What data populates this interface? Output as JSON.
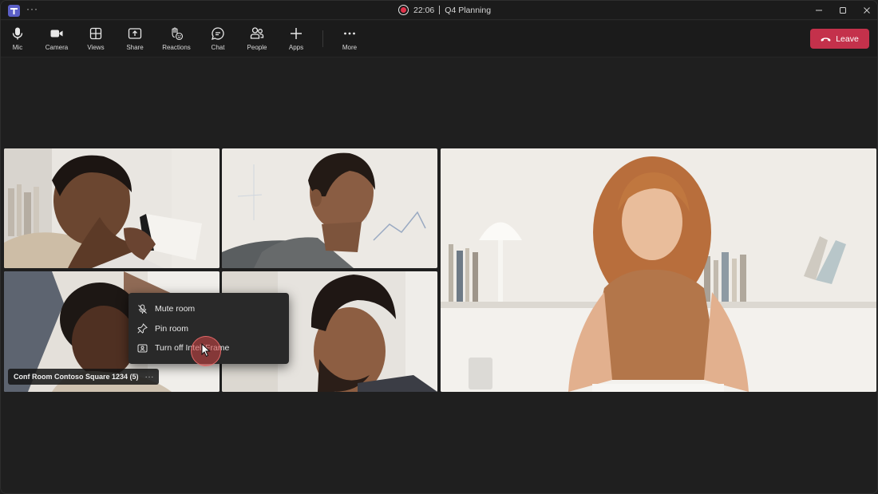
{
  "window": {
    "time": "22:06",
    "title": "Q4 Planning",
    "accent": "#5b5fc7",
    "record_color": "#e0324a"
  },
  "toolbar": {
    "items": [
      {
        "label": "Mic",
        "icon": "mic-icon"
      },
      {
        "label": "Camera",
        "icon": "camera-icon"
      },
      {
        "label": "Views",
        "icon": "views-icon"
      },
      {
        "label": "Share",
        "icon": "share-icon"
      },
      {
        "label": "Reactions",
        "icon": "reactions-icon"
      },
      {
        "label": "Chat",
        "icon": "chat-icon"
      },
      {
        "label": "People",
        "icon": "people-icon"
      },
      {
        "label": "Apps",
        "icon": "plus-icon"
      },
      {
        "label": "More",
        "icon": "more-icon"
      }
    ],
    "leave_label": "Leave",
    "leave_color": "#c4314b"
  },
  "stage": {
    "room_label": "Conf Room Contoso Square 1234 (5)",
    "context_menu": [
      {
        "label": "Mute room",
        "icon": "mic-off-icon"
      },
      {
        "label": "Pin room",
        "icon": "pin-icon"
      },
      {
        "label": "Turn off IntelliFrame",
        "icon": "intelliframe-icon"
      }
    ]
  }
}
